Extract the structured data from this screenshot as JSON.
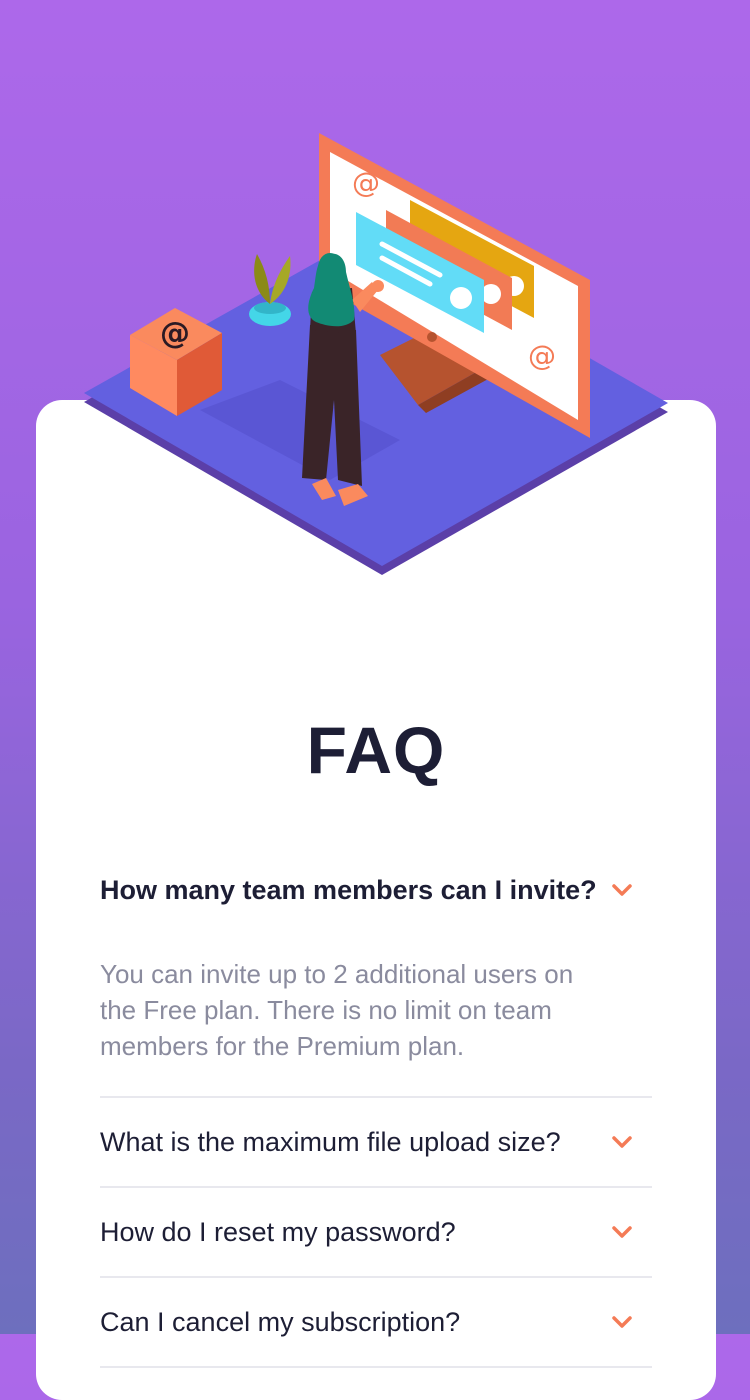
{
  "page": {
    "title": "FAQ"
  },
  "faq": [
    {
      "question": "How many team members can I invite?",
      "answer": "You can invite up to 2 additional users on the Free plan. There is no limit on team members for the Premium plan.",
      "expanded": true
    },
    {
      "question": "What is the maximum file upload size?",
      "expanded": false
    },
    {
      "question": "How do I reset my password?",
      "expanded": false
    },
    {
      "question": "Can I cancel my subscription?",
      "expanded": false
    }
  ],
  "colors": {
    "background_top": "#ad68ea",
    "background_bottom": "#6d6fbe",
    "card": "#ffffff",
    "text_dark": "#1d1e35",
    "text_muted": "#8a8b9e",
    "accent": "#f47b56",
    "divider": "#e8e8ee",
    "platform": "#6360e0"
  },
  "icons": {
    "chevron": "chevron-down-icon",
    "email": "at-sign-icon"
  }
}
